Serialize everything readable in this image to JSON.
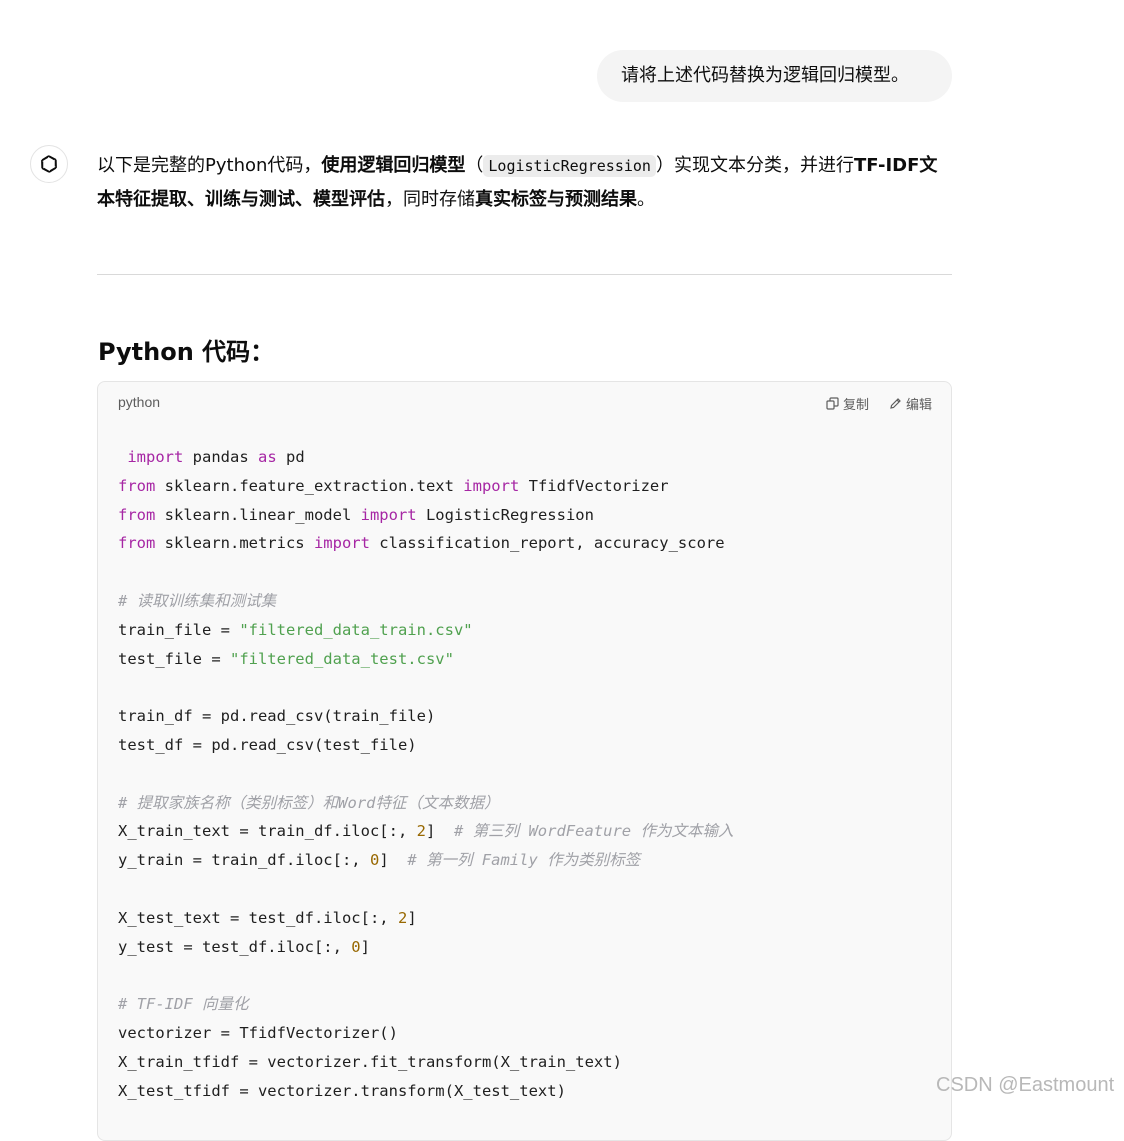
{
  "user_message": "请将上述代码替换为逻辑回归模型。",
  "assistant": {
    "avatar_icon": "openai-logo-icon",
    "intro": {
      "p1": "以下是完整的Python代码，",
      "b1": "使用逻辑回归模型",
      "p2": "（",
      "code1": "LogisticRegression",
      "p3": "）实现文本分类，并进行",
      "b2": "TF-IDF文本特征提取、训练与测试、模型评估",
      "p4": "，同时存储",
      "b3": "真实标签与预测结果",
      "p5": "。"
    },
    "section_title": "Python 代码："
  },
  "code_block": {
    "language": "python",
    "copy_label": "复制",
    "edit_label": "编辑",
    "lines": {
      "l1": {
        "k1": "import",
        "t1": " pandas ",
        "k2": "as",
        "t2": " pd"
      },
      "l2": {
        "k1": "from",
        "t1": " sklearn.feature_extraction.text ",
        "k2": "import",
        "t2": " TfidfVectorizer"
      },
      "l3": {
        "k1": "from",
        "t1": " sklearn.linear_model ",
        "k2": "import",
        "t2": " LogisticRegression"
      },
      "l4": {
        "k1": "from",
        "t1": " sklearn.metrics ",
        "k2": "import",
        "t2": " classification_report, accuracy_score"
      },
      "l5": {
        "c": "# 读取训练集和测试集"
      },
      "l6": {
        "t1": "train_file = ",
        "s": "\"filtered_data_train.csv\""
      },
      "l7": {
        "t1": "test_file = ",
        "s": "\"filtered_data_test.csv\""
      },
      "l8": {
        "t1": "train_df = pd.read_csv(train_file)"
      },
      "l9": {
        "t1": "test_df = pd.read_csv(test_file)"
      },
      "l10": {
        "c": "# 提取家族名称（类别标签）和Word特征（文本数据）"
      },
      "l11": {
        "t1": "X_train_text = train_df.iloc[:, ",
        "n": "2",
        "t2": "]  ",
        "c": "# 第三列 WordFeature 作为文本输入"
      },
      "l12": {
        "t1": "y_train = train_df.iloc[:, ",
        "n": "0",
        "t2": "]  ",
        "c": "# 第一列 Family 作为类别标签"
      },
      "l13": {
        "t1": "X_test_text = test_df.iloc[:, ",
        "n": "2",
        "t2": "]"
      },
      "l14": {
        "t1": "y_test = test_df.iloc[:, ",
        "n": "0",
        "t2": "]"
      },
      "l15": {
        "c": "# TF-IDF 向量化"
      },
      "l16": {
        "t1": "vectorizer = TfidfVectorizer()"
      },
      "l17": {
        "t1": "X_train_tfidf = vectorizer.fit_transform(X_train_text)"
      },
      "l18": {
        "t1": "X_test_tfidf = vectorizer.transform(X_test_text)"
      }
    }
  },
  "watermark": "CSDN @Eastmount"
}
